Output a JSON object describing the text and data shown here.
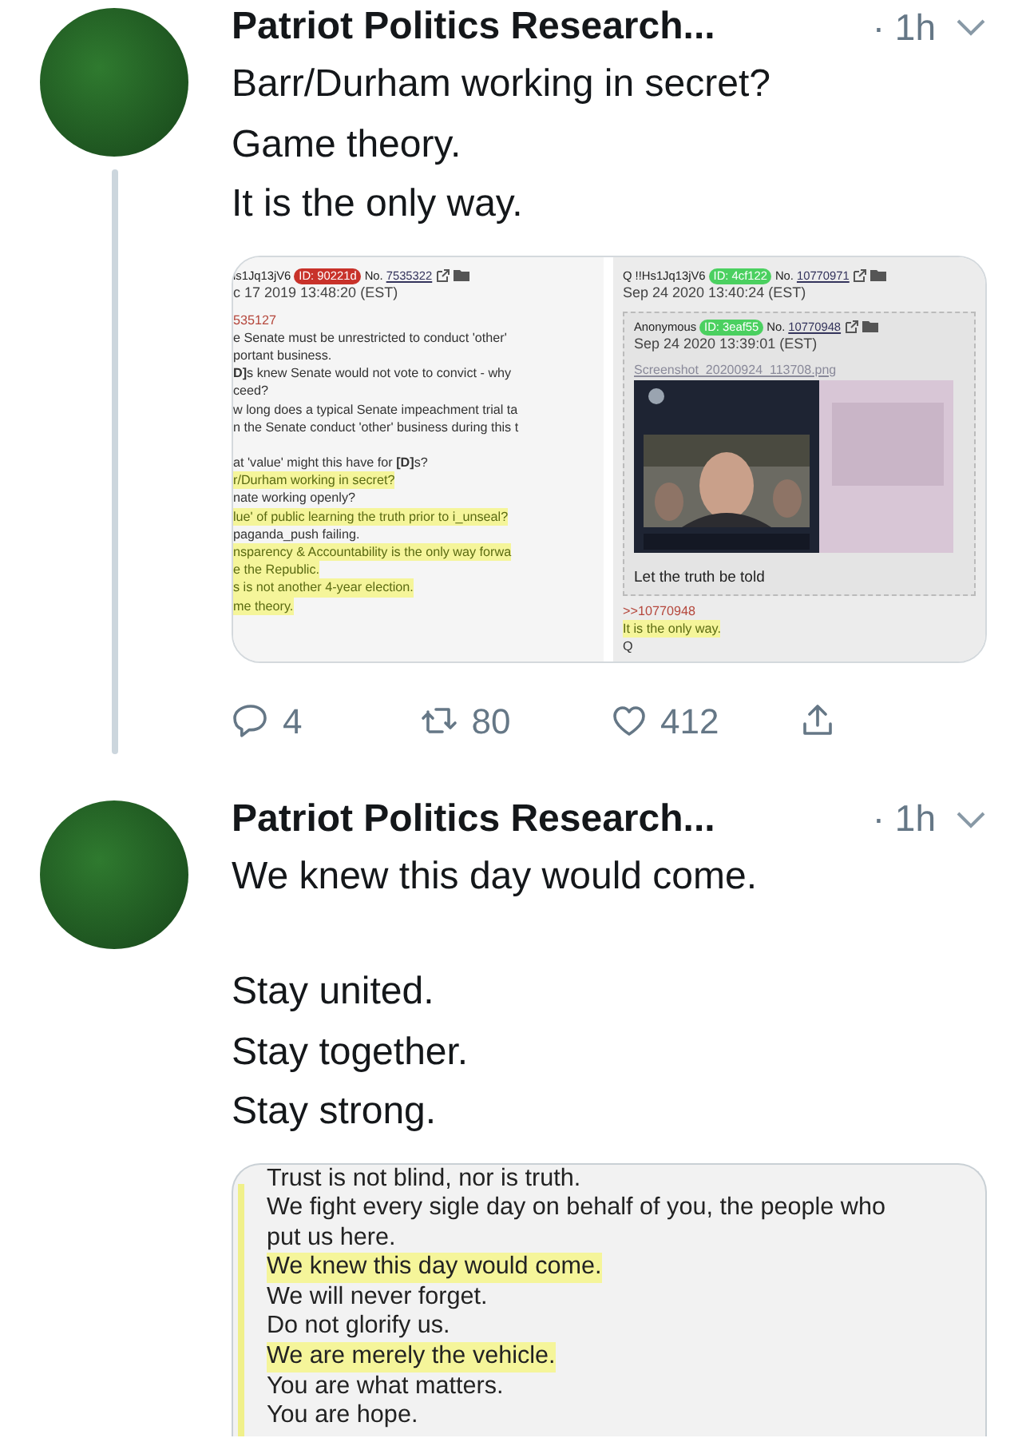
{
  "tweets": [
    {
      "author": "Patriot Politics Research...",
      "time": "· 1h",
      "thread_line": true,
      "paragraphs": [
        [
          "Barr/Durham working in secret?",
          "Game theory.",
          "It is the only way."
        ]
      ],
      "media": {
        "kind": "forum_posts",
        "posts": [
          {
            "header": {
              "name": "is1Jq13jV6",
              "id": "ID: 90221d",
              "color": "#c8322a",
              "no_label": "No.",
              "no": "7535322"
            },
            "date": "c 17 2019 13:48:20 (EST)",
            "lines": [
              {
                "kind": "ref",
                "text": "535127",
                "highlight": false
              },
              {
                "kind": "text",
                "text": "e Senate must be unrestricted to conduct 'other'",
                "highlight": false
              },
              {
                "kind": "text",
                "text": "portant business.",
                "highlight": false
              },
              {
                "kind": "text",
                "text": "**D]**s knew Senate would not vote to convict - why",
                "highlight": false
              },
              {
                "kind": "text",
                "text": "ceed?",
                "highlight": false
              },
              {
                "kind": "text",
                "text": "w long does a typical Senate impeachment trial ta",
                "highlight": false
              },
              {
                "kind": "text",
                "text": "n the Senate conduct 'other' business during this t",
                "highlight": false
              },
              {
                "kind": "gap"
              },
              {
                "kind": "text",
                "text": "at 'value' might this have for **[D]**s?",
                "highlight": false
              },
              {
                "kind": "text",
                "text": "r/Durham working in secret?",
                "highlight": true
              },
              {
                "kind": "text",
                "text": "nate working openly?",
                "highlight": false
              },
              {
                "kind": "text",
                "text": "lue' of public learning the truth prior to i_unseal?",
                "highlight": true
              },
              {
                "kind": "text",
                "text": "paganda_push failing.",
                "highlight": false
              },
              {
                "kind": "text",
                "text": "nsparency & Accountability is the only way forwa",
                "highlight": true
              },
              {
                "kind": "text",
                "text": "e the Republic.",
                "highlight": true
              },
              {
                "kind": "text",
                "text": "s is not another 4-year election.",
                "highlight": true
              },
              {
                "kind": "text",
                "text": "me theory.",
                "highlight": true
              }
            ]
          },
          {
            "header": {
              "name": "Q !!Hs1Jq13jV6",
              "id": "ID: 4cf122",
              "color": "#4bd060",
              "no_label": "No.",
              "no": "10770971"
            },
            "date": "Sep 24 2020 13:40:24 (EST)",
            "quote": {
              "header": {
                "name": "Anonymous",
                "id": "ID: 3eaf55",
                "color": "#4bd060",
                "no_label": "No.",
                "no": "10770948"
              },
              "date": "Sep 24 2020 13:39:01 (EST)",
              "file": "Screenshot_20200924_113708.png",
              "caption": "Let the truth be told"
            },
            "lines": [
              {
                "kind": "ref",
                "text": ">>10770948",
                "highlight": false
              },
              {
                "kind": "text",
                "text": "It is the only way.",
                "highlight": true
              },
              {
                "kind": "text",
                "text": "Q",
                "highlight": false
              }
            ]
          }
        ]
      },
      "actions": [
        {
          "kind": "reply",
          "count": "4"
        },
        {
          "kind": "retweet",
          "count": "80"
        },
        {
          "kind": "like",
          "count": "412"
        },
        {
          "kind": "share"
        }
      ]
    },
    {
      "author": "Patriot Politics Research...",
      "time": "· 1h",
      "thread_line": false,
      "paragraphs": [
        [
          "We knew this day would come."
        ],
        [
          "Stay united.",
          "Stay together.",
          "Stay strong."
        ]
      ],
      "media": {
        "kind": "text_post",
        "lines": [
          {
            "text": "Trust is not blind, nor is truth.",
            "highlight": false
          },
          {
            "text": "We fight every sigle day on behalf of you, the people who put us here.",
            "highlight": false
          },
          {
            "text": "We knew this day would come.",
            "highlight": true
          },
          {
            "text": "We will never forget.",
            "highlight": false
          },
          {
            "text": "Do not glorify us.",
            "highlight": false
          },
          {
            "text": "We are merely the vehicle.",
            "highlight": true
          },
          {
            "text": "You are what matters.",
            "highlight": false
          },
          {
            "text": "You are hope.",
            "highlight": false
          }
        ]
      }
    }
  ]
}
